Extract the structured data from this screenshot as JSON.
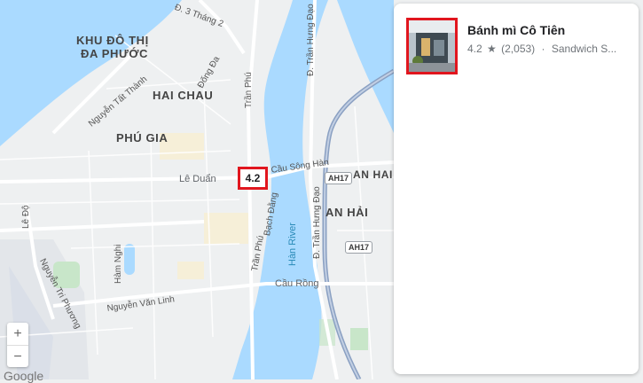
{
  "map": {
    "areas": {
      "khu_do_thi": "KHU ĐÔ THỊ",
      "da_phuoc": "ĐA PHƯỚC",
      "hai_chau": "HAI CHAU",
      "phu_gia": "PHÚ GIA",
      "an_hai": "AN HẢI",
      "an_hai_bac": "AN HAI"
    },
    "streets": {
      "thang2": "Đ. 3 Tháng 2",
      "tran_hung_dao_top": "Đ. Trần Hưng Đạo",
      "dong_da": "Đống Đa",
      "tran_phu_top": "Trần Phú",
      "nguyen_tat_thanh": "Nguyễn Tất Thành",
      "le_duan": "Lê Duẩn",
      "song_han": "Cầu Sông Hàn",
      "tran_phu": "Trần Phú",
      "bach_dang": "Bạch Đằng",
      "tran_hung_dao": "Đ. Trần Hưng Đạo",
      "le_do": "Lê Độ",
      "ham_nghi": "Hàm Nghi",
      "nguyen_tri_phuong": "Nguyễn Tri Phương",
      "nguyen_van_linh": "Nguyễn Văn Linh",
      "cau_rong": "Cầu Rồng"
    },
    "river": "Hàn River",
    "shields": [
      "AH17",
      "AH17"
    ],
    "pin_rating": "4.2",
    "zoom_in": "+",
    "zoom_out": "−",
    "attribution": "Google",
    "colors": {
      "water": "#aadaff",
      "land": "#eef0f1",
      "highway": "#8aa0c2",
      "pin_border": "#e1161e"
    }
  },
  "panel": {
    "place_name": "Bánh mì Cô Tiên",
    "rating": "4.2",
    "star_icon": "star-icon",
    "reviews": "(2,053)",
    "separator": "·",
    "category": "Sandwich S..."
  }
}
